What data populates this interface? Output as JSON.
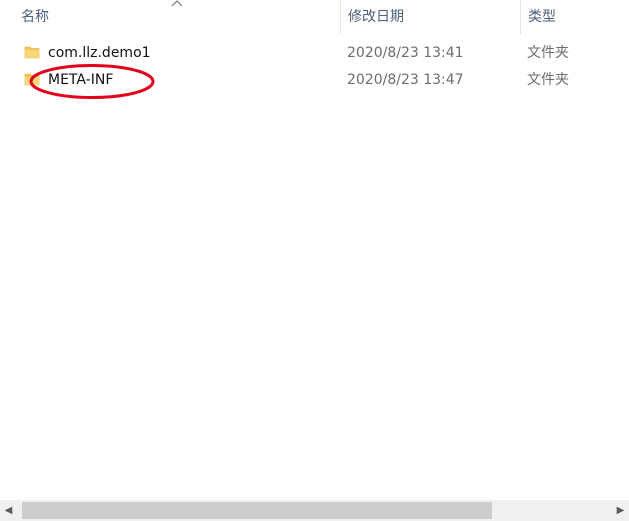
{
  "header": {
    "name_label": "名称",
    "date_label": "修改日期",
    "type_label": "类型"
  },
  "files": [
    {
      "name": "com.llz.demo1",
      "modified": "2020/8/23 13:41",
      "type": "文件夹",
      "icon": "folder-icon"
    },
    {
      "name": "META-INF",
      "modified": "2020/8/23 13:47",
      "type": "文件夹",
      "icon": "folder-icon",
      "highlighted": true
    }
  ],
  "colors": {
    "folder": "#f3c65a",
    "folder_dark": "#dcaa3a",
    "annotation": "#e3001b",
    "header_text": "#4c607a"
  },
  "scrollbar": {
    "left_arrow": "◀",
    "right_arrow": "▶"
  }
}
